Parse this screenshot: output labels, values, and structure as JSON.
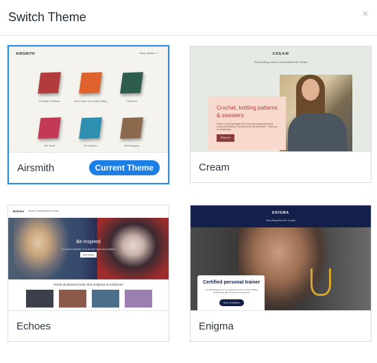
{
  "dialog": {
    "title": "Switch Theme",
    "close_icon": "×"
  },
  "themes": [
    {
      "name": "Airsmith",
      "current_label": "Current Theme",
      "preview": {
        "logo": "AIRSMITH",
        "nav": "Shop   Journal      ⌕  □",
        "books": [
          {
            "caption": "The Birds & The Bees",
            "color": "#b23c3c"
          },
          {
            "caption": "How to Make Your Garden Gallery",
            "color": "#e0622c"
          },
          {
            "caption": "The Burrow",
            "color": "#2c5d4d"
          },
          {
            "caption": "Time Travel",
            "color": "#c23a56"
          },
          {
            "caption": "The Gardener",
            "color": "#2f8fb0"
          },
          {
            "caption": "World Mapping",
            "color": "#8c6a4e"
          }
        ]
      }
    },
    {
      "name": "Cream",
      "preview": {
        "logo": "CREAM",
        "nav": "Shop    Knitting Lessons    Journal    About Me    Contact",
        "heading": "Crochet, knitting patterns & sweaters",
        "body": "Hello! I'm Amy Montague and I am crazy passionate about crochet and knitting. You can find all my useful fibre. Thank you for stopping by.",
        "button": "Shop now"
      }
    },
    {
      "name": "Echoes",
      "preview": {
        "logo": "Echoes",
        "nav": "Books   Journal   About   Contact",
        "heading": "Be Inspired",
        "sub": "An eclectic collection of books that inspire and enlighten",
        "button": "Shop Books",
        "strap": "Richly illustrated books that enlighten & exhilarate"
      }
    },
    {
      "name": "Enigma",
      "preview": {
        "logo": "ENIGMA",
        "nav": "Shop   Blog   About Me   Contact",
        "heading": "Certified personal trainer",
        "body": "I'm Matt Briggs and I'm a weight loss and muscle building professional with 20 years of experience.",
        "button": "Book consultation"
      }
    }
  ]
}
